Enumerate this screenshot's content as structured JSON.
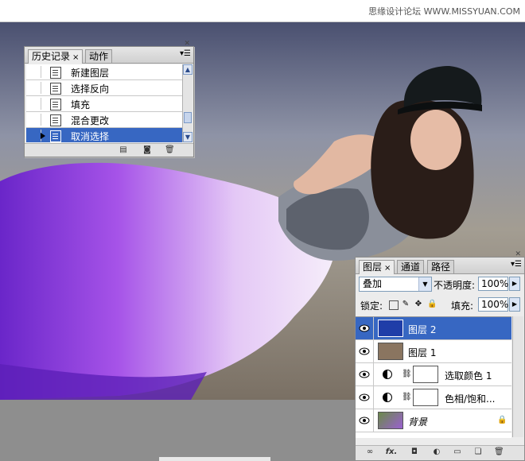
{
  "watermark": "思缘设计论坛 WWW.MISSYUAN.COM",
  "history_panel": {
    "tabs": [
      {
        "label": "历史记录",
        "close": "×"
      },
      {
        "label": "动作"
      }
    ],
    "items": [
      {
        "label": "新建图层"
      },
      {
        "label": "选择反向"
      },
      {
        "label": "填充"
      },
      {
        "label": "混合更改"
      },
      {
        "label": "取消选择",
        "selected": true
      }
    ]
  },
  "layers_panel": {
    "tabs": [
      {
        "label": "图层",
        "close": "×"
      },
      {
        "label": "通道"
      },
      {
        "label": "路径"
      }
    ],
    "blend_mode": "叠加",
    "opacity_label": "不透明度:",
    "opacity_value": "100%",
    "lock_label": "锁定:",
    "fill_label": "填充:",
    "fill_value": "100%",
    "layers": [
      {
        "name": "图层 2",
        "selected": true,
        "thumb_color": "#1f3da8"
      },
      {
        "name": "图层 1",
        "thumb_color": "#8a7560"
      },
      {
        "name": "选取颜色 1",
        "type": "adjustment"
      },
      {
        "name": "色相/饱和...",
        "type": "adjustment"
      },
      {
        "name": "背景",
        "locked": true,
        "thumb_color": "#7a5aa8"
      }
    ],
    "footer_fx": "fx."
  },
  "colors": {
    "selection": "#3767c2",
    "panel_bg": "#ececec",
    "dress_purple": "#9d4fe6"
  }
}
